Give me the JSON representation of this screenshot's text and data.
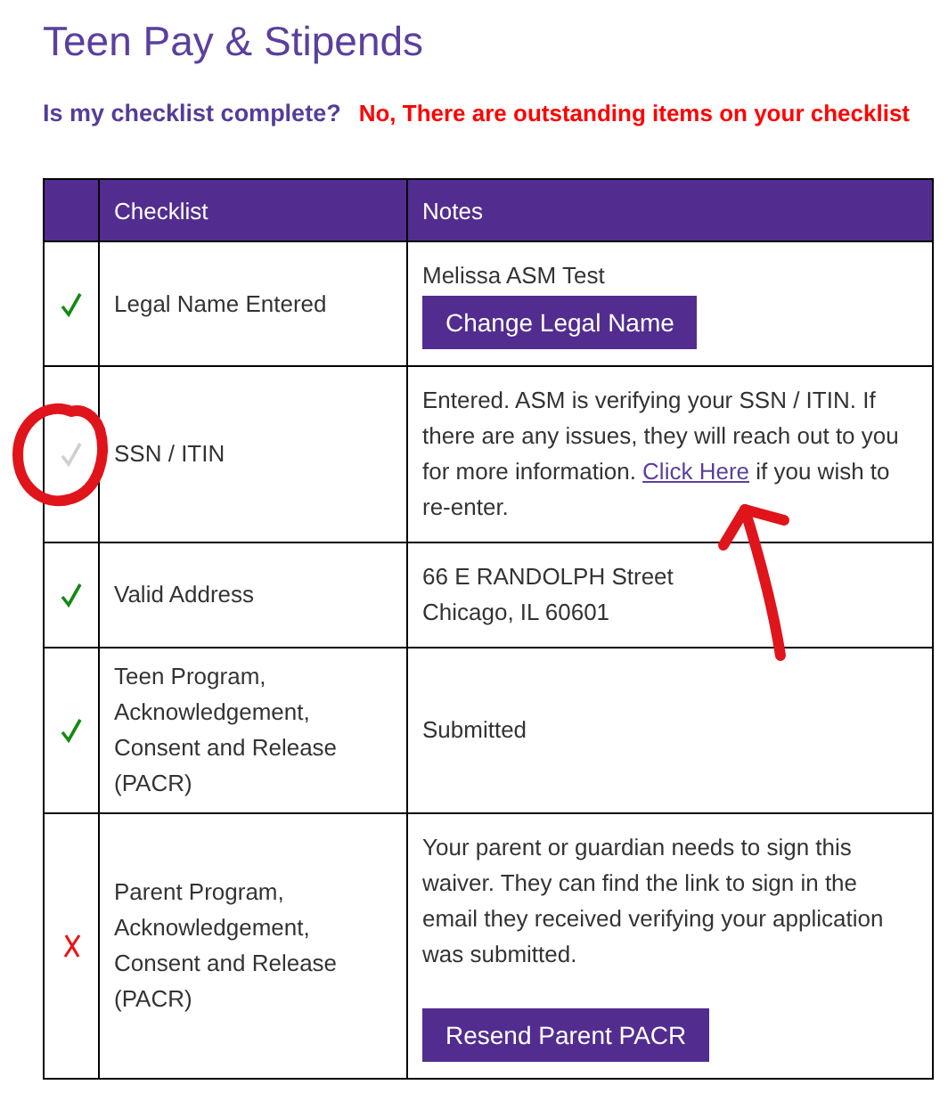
{
  "title": "Teen Pay & Stipends",
  "status": {
    "question": "Is my checklist complete?",
    "answer": "No, There are outstanding items on your checklist"
  },
  "table": {
    "columns": [
      "",
      "Checklist",
      "Notes"
    ],
    "rows": [
      {
        "checked": true,
        "greyed": false,
        "item": "Legal Name Entered",
        "notes": [
          {
            "kind": "text",
            "text": "Melissa ASM Test"
          },
          {
            "kind": "button",
            "text": "Change Legal Name"
          }
        ]
      },
      {
        "checked": true,
        "greyed": true,
        "item": "SSN / ITIN",
        "notes": [
          {
            "kind": "paragraph",
            "before": "Entered. ASM is verifying your SSN / ITIN. If there are any issues, they will reach out to you for more information.",
            "link": "Click Here",
            "after": "if you wish to re-enter."
          }
        ]
      },
      {
        "checked": true,
        "greyed": false,
        "item": "Valid Address",
        "notes": [
          {
            "kind": "text",
            "text": "66 E RANDOLPH Street"
          },
          {
            "kind": "text",
            "text": "Chicago, IL 60601"
          }
        ]
      },
      {
        "checked": true,
        "greyed": false,
        "item": "Teen Program, Acknowledgement, Consent and Release (PACR)",
        "notes": [
          {
            "kind": "text",
            "text": "Submitted"
          }
        ]
      },
      {
        "checked": false,
        "greyed": false,
        "item": "Parent Program, Acknowledgement, Consent and Release (PACR)",
        "notes": [
          {
            "kind": "text",
            "text": "Your parent or guardian needs to sign this waiver. They can find the link to sign in the email they received verifying your application was submitted."
          },
          {
            "kind": "button",
            "text": "Resend Parent PACR"
          }
        ]
      }
    ]
  }
}
